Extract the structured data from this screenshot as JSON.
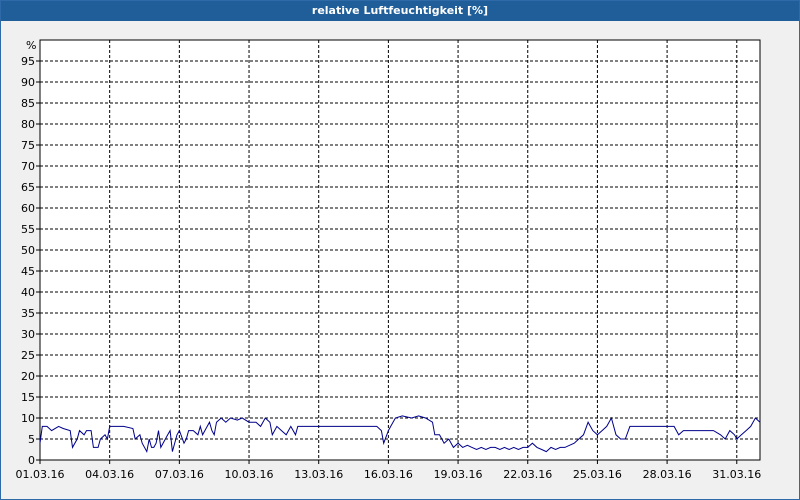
{
  "window": {
    "title": "relative Luftfeuchtigkeit [%]"
  },
  "chart_data": {
    "type": "line",
    "title": "relative Luftfeuchtigkeit [%]",
    "ylabel": "%",
    "xlabel": "",
    "ylim": [
      0,
      100
    ],
    "grid": true,
    "line_color": "#00008b",
    "y_ticks": [
      "0",
      "5",
      "10",
      "15",
      "20",
      "25",
      "30",
      "35",
      "40",
      "45",
      "50",
      "55",
      "60",
      "65",
      "70",
      "75",
      "80",
      "85",
      "90",
      "95"
    ],
    "x_ticks": [
      "01.03.16",
      "04.03.16",
      "07.03.16",
      "10.03.16",
      "13.03.16",
      "16.03.16",
      "19.03.16",
      "22.03.16",
      "25.03.16",
      "28.03.16",
      "31.03.16"
    ],
    "x_tick_days": [
      1,
      4,
      7,
      10,
      13,
      16,
      19,
      22,
      25,
      28,
      31
    ],
    "x_range_days": [
      1,
      32
    ],
    "series": [
      {
        "values": [
          [
            1.0,
            4
          ],
          [
            1.1,
            8
          ],
          [
            1.3,
            8
          ],
          [
            1.5,
            7
          ],
          [
            1.8,
            8
          ],
          [
            2.0,
            7.5
          ],
          [
            2.3,
            7
          ],
          [
            2.4,
            3
          ],
          [
            2.6,
            5
          ],
          [
            2.7,
            7
          ],
          [
            2.9,
            6
          ],
          [
            3.0,
            7
          ],
          [
            3.2,
            7
          ],
          [
            3.3,
            3
          ],
          [
            3.5,
            3
          ],
          [
            3.6,
            5
          ],
          [
            3.8,
            6
          ],
          [
            3.9,
            5
          ],
          [
            4.0,
            8
          ],
          [
            4.3,
            8
          ],
          [
            4.6,
            8
          ],
          [
            5.0,
            7.5
          ],
          [
            5.1,
            5
          ],
          [
            5.3,
            6
          ],
          [
            5.4,
            4
          ],
          [
            5.6,
            2
          ],
          [
            5.7,
            5
          ],
          [
            5.8,
            3
          ],
          [
            5.9,
            3
          ],
          [
            6.0,
            4
          ],
          [
            6.1,
            7
          ],
          [
            6.2,
            3
          ],
          [
            6.4,
            5
          ],
          [
            6.5,
            6
          ],
          [
            6.6,
            7
          ],
          [
            6.7,
            2
          ],
          [
            6.9,
            6
          ],
          [
            7.0,
            7
          ],
          [
            7.2,
            4
          ],
          [
            7.3,
            5
          ],
          [
            7.4,
            7
          ],
          [
            7.6,
            7
          ],
          [
            7.8,
            6
          ],
          [
            7.9,
            8
          ],
          [
            8.0,
            6
          ],
          [
            8.2,
            8
          ],
          [
            8.3,
            9
          ],
          [
            8.4,
            7
          ],
          [
            8.5,
            6
          ],
          [
            8.6,
            9
          ],
          [
            8.8,
            10
          ],
          [
            9.0,
            9
          ],
          [
            9.2,
            10
          ],
          [
            9.5,
            9.5
          ],
          [
            9.7,
            10
          ],
          [
            10.0,
            9
          ],
          [
            10.3,
            9
          ],
          [
            10.5,
            8
          ],
          [
            10.7,
            10
          ],
          [
            10.9,
            9
          ],
          [
            11.0,
            6
          ],
          [
            11.2,
            8
          ],
          [
            11.4,
            7
          ],
          [
            11.6,
            6
          ],
          [
            11.8,
            8
          ],
          [
            12.0,
            6
          ],
          [
            12.1,
            8
          ],
          [
            12.5,
            8
          ],
          [
            13.0,
            8
          ],
          [
            14.0,
            8
          ],
          [
            14.5,
            8
          ],
          [
            15.0,
            8
          ],
          [
            15.5,
            8
          ],
          [
            15.7,
            7
          ],
          [
            15.8,
            4
          ],
          [
            16.0,
            7
          ],
          [
            16.1,
            8
          ],
          [
            16.3,
            10
          ],
          [
            16.6,
            10.5
          ],
          [
            17.0,
            10
          ],
          [
            17.3,
            10.5
          ],
          [
            17.6,
            10
          ],
          [
            17.9,
            9
          ],
          [
            18.0,
            6
          ],
          [
            18.2,
            6
          ],
          [
            18.4,
            4
          ],
          [
            18.6,
            5
          ],
          [
            18.8,
            3
          ],
          [
            19.0,
            4
          ],
          [
            19.2,
            3
          ],
          [
            19.4,
            3.5
          ],
          [
            19.6,
            3
          ],
          [
            19.8,
            2.5
          ],
          [
            20.0,
            3
          ],
          [
            20.2,
            2.5
          ],
          [
            20.4,
            3
          ],
          [
            20.6,
            3
          ],
          [
            20.8,
            2.5
          ],
          [
            21.0,
            3
          ],
          [
            21.2,
            2.5
          ],
          [
            21.4,
            3
          ],
          [
            21.6,
            2.5
          ],
          [
            21.8,
            3
          ],
          [
            22.0,
            3
          ],
          [
            22.2,
            4
          ],
          [
            22.4,
            3
          ],
          [
            22.6,
            2.5
          ],
          [
            22.8,
            2
          ],
          [
            23.0,
            3
          ],
          [
            23.2,
            2.5
          ],
          [
            23.4,
            3
          ],
          [
            23.6,
            3
          ],
          [
            23.8,
            3.5
          ],
          [
            24.0,
            4
          ],
          [
            24.2,
            5
          ],
          [
            24.4,
            6
          ],
          [
            24.6,
            9
          ],
          [
            24.8,
            7
          ],
          [
            25.0,
            6
          ],
          [
            25.2,
            7
          ],
          [
            25.4,
            8
          ],
          [
            25.6,
            10
          ],
          [
            25.8,
            6
          ],
          [
            26.0,
            5
          ],
          [
            26.2,
            5
          ],
          [
            26.4,
            8
          ],
          [
            26.6,
            8
          ],
          [
            27.0,
            8
          ],
          [
            27.5,
            8
          ],
          [
            28.0,
            8
          ],
          [
            28.3,
            8
          ],
          [
            28.5,
            6
          ],
          [
            28.7,
            7
          ],
          [
            29.0,
            7
          ],
          [
            29.5,
            7
          ],
          [
            30.0,
            7
          ],
          [
            30.3,
            6
          ],
          [
            30.5,
            5
          ],
          [
            30.7,
            7
          ],
          [
            30.9,
            6
          ],
          [
            31.0,
            5
          ],
          [
            31.2,
            6
          ],
          [
            31.4,
            7
          ],
          [
            31.6,
            8
          ],
          [
            31.8,
            10
          ],
          [
            32.0,
            9
          ]
        ]
      }
    ]
  }
}
